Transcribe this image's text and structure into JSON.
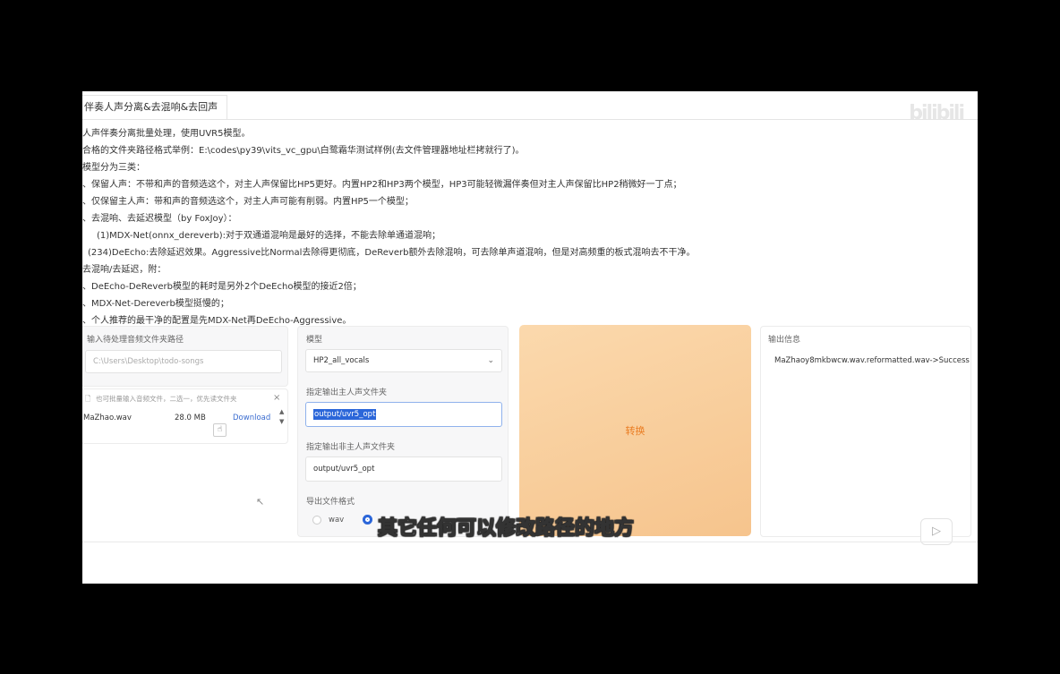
{
  "tab": {
    "label": "伴奏人声分离&去混响&去回声"
  },
  "watermark": "bilibili",
  "description": {
    "lines": [
      "人声伴奏分离批量处理，使用UVR5模型。",
      "合格的文件夹路径格式举例：E:\\codes\\py39\\vits_vc_gpu\\白鹭霜华测试样例(去文件管理器地址栏拷就行了)。",
      "模型分为三类：",
      "、保留人声：不带和声的音频选这个，对主人声保留比HP5更好。内置HP2和HP3两个模型，HP3可能轻微漏伴奏但对主人声保留比HP2稍微好一丁点；",
      "、仅保留主人声：带和声的音频选这个，对主人声可能有削弱。内置HP5一个模型；",
      "、去混响、去延迟模型（by FoxJoy）：",
      "(1)MDX-Net(onnx_dereverb):对于双通道混响是最好的选择，不能去除单通道混响；",
      "(234)DeEcho:去除延迟效果。Aggressive比Normal去除得更彻底，DeReverb额外去除混响，可去除单声道混响，但是对高频重的板式混响去不干净。",
      "去混响/去延迟，附：",
      "、DeEcho-DeReverb模型的耗时是另外2个DeEcho模型的接近2倍；",
      "、MDX-Net-Dereverb模型挺慢的；",
      "、个人推荐的最干净的配置是先MDX-Net再DeEcho-Aggressive。"
    ]
  },
  "input_panel": {
    "folder_label": "输入待处理音频文件夹路径",
    "folder_placeholder": "C:\\Users\\Desktop\\todo-songs",
    "upload_hint": "也可批量输入音频文件，二选一，优先读文件夹",
    "file_name": "MaZhao.wav",
    "file_size": "28.0 MB",
    "download_label": "Download"
  },
  "model_panel": {
    "model_label": "模型",
    "model_value": "HP2_all_vocals",
    "vocal_dir_label": "指定输出主人声文件夹",
    "vocal_dir_value": "output/uvr5_opt",
    "instrument_dir_label": "指定输出非主人声文件夹",
    "instrument_dir_value": "output/uvr5_opt",
    "format_label": "导出文件格式",
    "format_options": [
      "wav"
    ]
  },
  "convert_button": {
    "label": "转换"
  },
  "output_panel": {
    "label": "输出信息",
    "message": "MaZhaoy8mkbwcw.wav.reformatted.wav->Success"
  },
  "subtitle": "其它任何可以修改路径的地方",
  "colors": {
    "accent": "#ea7d23",
    "button_bg": "#f8cd9b",
    "selection": "#2b66d9"
  }
}
